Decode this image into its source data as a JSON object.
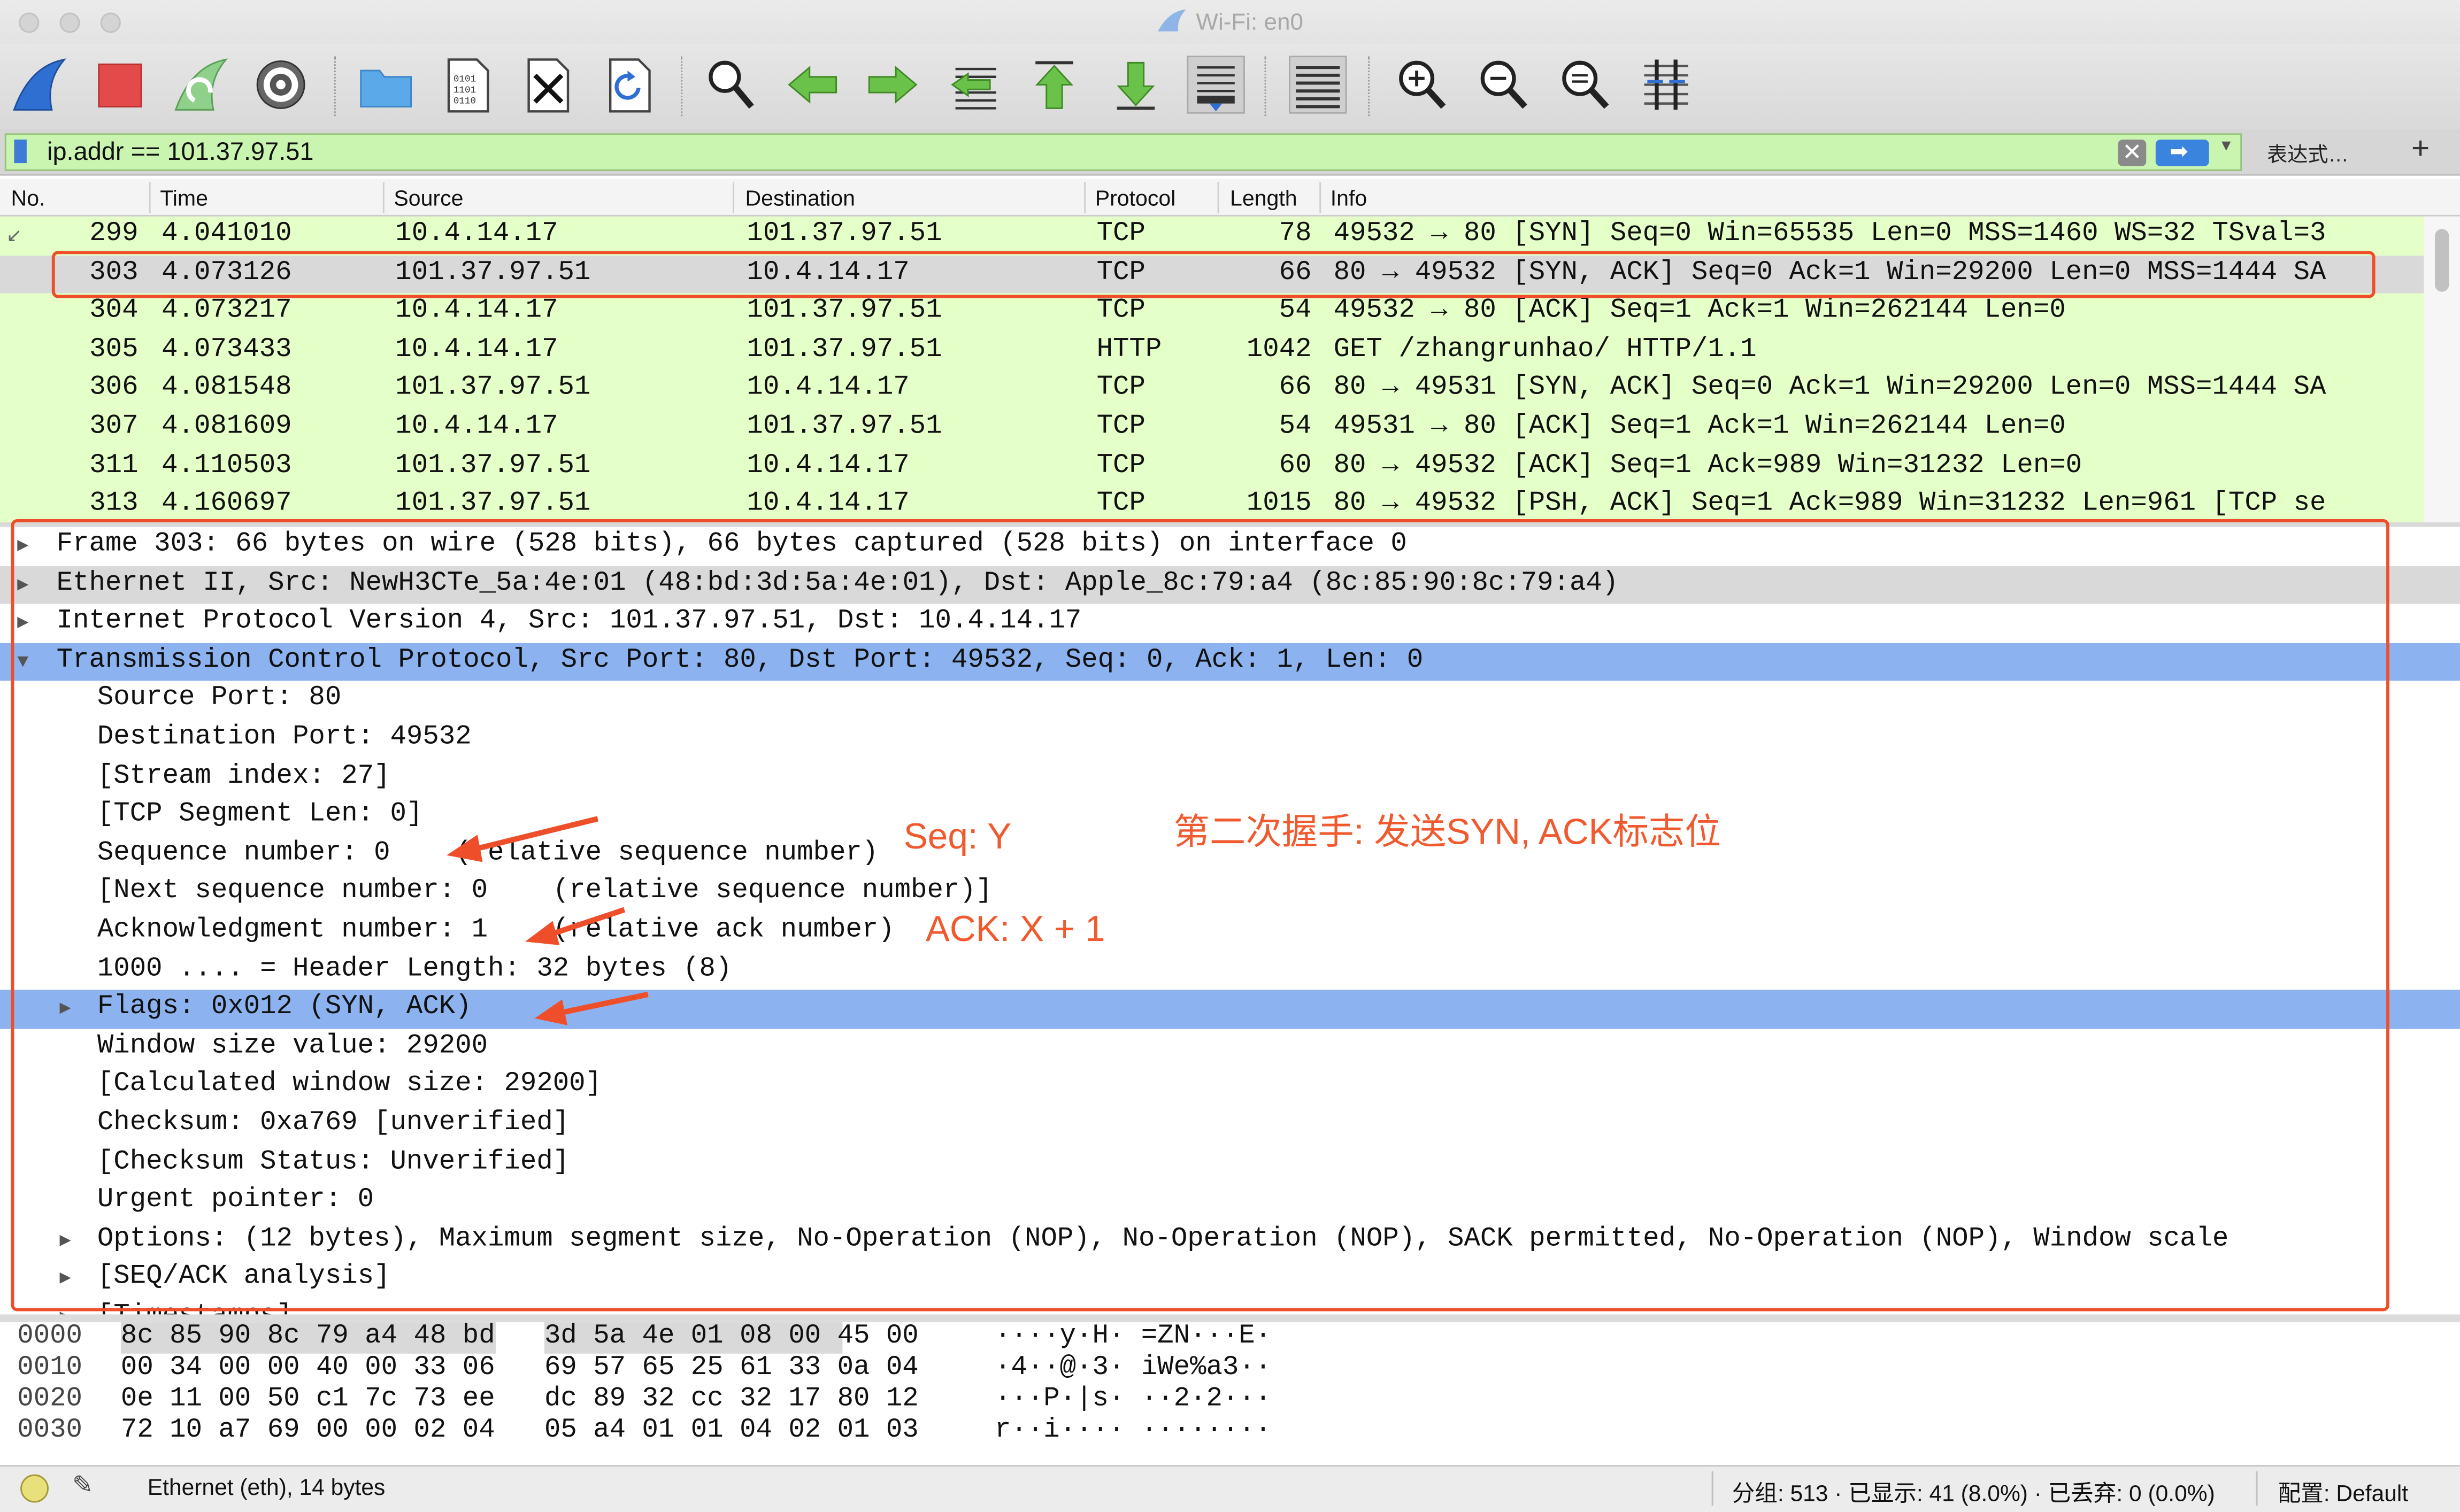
{
  "window": {
    "title": "Wi-Fi: en0"
  },
  "toolbar": {
    "buttons": [
      "start-capture",
      "stop-capture",
      "restart-capture",
      "capture-options",
      "open-file",
      "save-file",
      "close-file",
      "reload-file",
      "find-packet",
      "go-back",
      "go-forward",
      "go-to-packet",
      "go-first",
      "go-last",
      "auto-scroll",
      "colorize",
      "zoom-in",
      "zoom-out",
      "zoom-normal",
      "resize-columns"
    ]
  },
  "filter": {
    "value": "ip.addr == 101.37.97.51",
    "expression_label": "表达式…",
    "plus_label": "+"
  },
  "packet_list": {
    "columns": [
      "No.",
      "Time",
      "Source",
      "Destination",
      "Protocol",
      "Length",
      "Info"
    ],
    "rows": [
      {
        "no": "299",
        "time": "4.041010",
        "src": "10.4.14.17",
        "dst": "101.37.97.51",
        "proto": "TCP",
        "len": "78",
        "info": "49532 → 80 [SYN] Seq=0 Win=65535 Len=0 MSS=1460 WS=32 TSval=3"
      },
      {
        "no": "303",
        "time": "4.073126",
        "src": "101.37.97.51",
        "dst": "10.4.14.17",
        "proto": "TCP",
        "len": "66",
        "info": "80 → 49532 [SYN, ACK] Seq=0 Ack=1 Win=29200 Len=0 MSS=1444 SA"
      },
      {
        "no": "304",
        "time": "4.073217",
        "src": "10.4.14.17",
        "dst": "101.37.97.51",
        "proto": "TCP",
        "len": "54",
        "info": "49532 → 80 [ACK] Seq=1 Ack=1 Win=262144 Len=0"
      },
      {
        "no": "305",
        "time": "4.073433",
        "src": "10.4.14.17",
        "dst": "101.37.97.51",
        "proto": "HTTP",
        "len": "1042",
        "info": "GET /zhangrunhao/ HTTP/1.1"
      },
      {
        "no": "306",
        "time": "4.081548",
        "src": "101.37.97.51",
        "dst": "10.4.14.17",
        "proto": "TCP",
        "len": "66",
        "info": "80 → 49531 [SYN, ACK] Seq=0 Ack=1 Win=29200 Len=0 MSS=1444 SA"
      },
      {
        "no": "307",
        "time": "4.081609",
        "src": "10.4.14.17",
        "dst": "101.37.97.51",
        "proto": "TCP",
        "len": "54",
        "info": "49531 → 80 [ACK] Seq=1 Ack=1 Win=262144 Len=0"
      },
      {
        "no": "311",
        "time": "4.110503",
        "src": "101.37.97.51",
        "dst": "10.4.14.17",
        "proto": "TCP",
        "len": "60",
        "info": "80 → 49532 [ACK] Seq=1 Ack=989 Win=31232 Len=0"
      },
      {
        "no": "313",
        "time": "4.160697",
        "src": "101.37.97.51",
        "dst": "10.4.14.17",
        "proto": "TCP",
        "len": "1015",
        "info": "80 → 49532 [PSH, ACK] Seq=1 Ack=989 Win=31232 Len=961 [TCP se"
      }
    ]
  },
  "detail": {
    "lines": [
      {
        "text": "Frame 303: 66 bytes on wire (528 bits), 66 bytes captured (528 bits) on interface 0",
        "arrow": "▶"
      },
      {
        "text": "Ethernet II, Src: NewH3CTe_5a:4e:01 (48:bd:3d:5a:4e:01), Dst: Apple_8c:79:a4 (8c:85:90:8c:79:a4)",
        "arrow": "▶"
      },
      {
        "text": "Internet Protocol Version 4, Src: 101.37.97.51, Dst: 10.4.14.17",
        "arrow": "▶"
      },
      {
        "text": "Transmission Control Protocol, Src Port: 80, Dst Port: 49532, Seq: 0, Ack: 1, Len: 0",
        "arrow": "▼"
      },
      {
        "text": "Source Port: 80",
        "arrow": ""
      },
      {
        "text": "Destination Port: 49532",
        "arrow": ""
      },
      {
        "text": "[Stream index: 27]",
        "arrow": ""
      },
      {
        "text": "[TCP Segment Len: 0]",
        "arrow": ""
      },
      {
        "text": "Sequence number: 0    (relative sequence number)",
        "arrow": ""
      },
      {
        "text": "[Next sequence number: 0    (relative sequence number)]",
        "arrow": ""
      },
      {
        "text": "Acknowledgment number: 1    (relative ack number)",
        "arrow": ""
      },
      {
        "text": "1000 .... = Header Length: 32 bytes (8)",
        "arrow": ""
      },
      {
        "text": "Flags: 0x012 (SYN, ACK)",
        "arrow": "▶"
      },
      {
        "text": "Window size value: 29200",
        "arrow": ""
      },
      {
        "text": "[Calculated window size: 29200]",
        "arrow": ""
      },
      {
        "text": "Checksum: 0xa769 [unverified]",
        "arrow": ""
      },
      {
        "text": "[Checksum Status: Unverified]",
        "arrow": ""
      },
      {
        "text": "Urgent pointer: 0",
        "arrow": ""
      },
      {
        "text": "Options: (12 bytes), Maximum segment size, No-Operation (NOP), No-Operation (NOP), SACK permitted, No-Operation (NOP), Window scale",
        "arrow": "▶"
      },
      {
        "text": "[SEQ/ACK analysis]",
        "arrow": "▶"
      },
      {
        "text": "[Timestamps]",
        "arrow": "▶"
      }
    ]
  },
  "bytes": {
    "rows": [
      {
        "offset": "0000",
        "hex_a": "8c 85 90 8c 79 a4 48 bd",
        "hex_b": "3d 5a 4e 01 08 00 45 00",
        "ascii": "····y·H· =ZN···E·"
      },
      {
        "offset": "0010",
        "hex_a": "00 34 00 00 40 00 33 06",
        "hex_b": "69 57 65 25 61 33 0a 04",
        "ascii": "·4··@·3· iWe%a3··"
      },
      {
        "offset": "0020",
        "hex_a": "0e 11 00 50 c1 7c 73 ee",
        "hex_b": "dc 89 32 cc 32 17 80 12",
        "ascii": "···P·|s· ··2·2···"
      },
      {
        "offset": "0030",
        "hex_a": "72 10 a7 69 00 00 02 04",
        "hex_b": "05 a4 01 01 04 02 01 03",
        "ascii": "r··i···· ········"
      }
    ]
  },
  "status": {
    "left": "Ethernet (eth), 14 bytes",
    "packets": "分组: 513 · 已显示: 41 (8.0%) · 已丢弃: 0 (0.0%)",
    "profile": "配置: Default"
  },
  "annotations": {
    "seq": "Seq: Y",
    "ack": "ACK: X + 1",
    "title": "第二次握手: 发送SYN, ACK标志位",
    "color": "#f05a2e"
  },
  "colors": {
    "tcp_row": "#e4ffc7",
    "selected_row": "#d9d9d9",
    "detail_selected": "#8cb3ef",
    "filter_bg": "#c9f5b0"
  }
}
